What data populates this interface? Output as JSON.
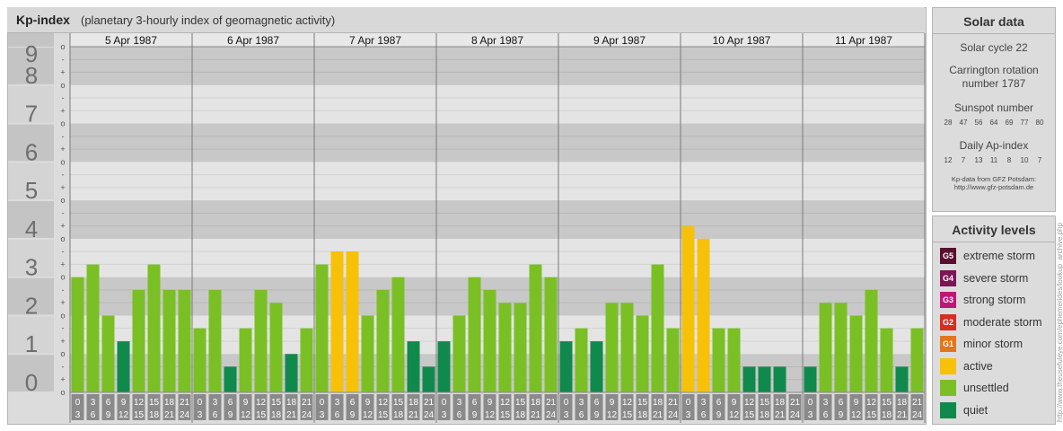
{
  "header": {
    "title": "Kp-index",
    "subtitle": "(planetary 3-hourly index of geomagnetic activity)"
  },
  "chart_data": {
    "type": "bar",
    "title": "Kp-index",
    "subtitle": "(planetary 3-hourly index of geomagnetic activity)",
    "ylim": [
      0,
      9
    ],
    "y_ticks": [
      "0",
      "1",
      "2",
      "3",
      "4",
      "5",
      "6",
      "7",
      "8",
      "9"
    ],
    "sub_ticks": [
      "-",
      "o",
      "+"
    ],
    "days": [
      "5 Apr 1987",
      "6 Apr 1987",
      "7 Apr 1987",
      "8 Apr 1987",
      "9 Apr 1987",
      "10 Apr 1987",
      "11 Apr 1987"
    ],
    "interval_top": [
      "0",
      "3",
      "6",
      "9",
      "12",
      "15",
      "18",
      "21"
    ],
    "interval_bottom": [
      "3",
      "6",
      "9",
      "12",
      "15",
      "18",
      "21",
      "24"
    ],
    "series": [
      {
        "values": [
          3.0,
          3.33,
          2.0,
          1.33,
          2.67,
          3.33,
          2.67,
          2.67
        ]
      },
      {
        "values": [
          1.67,
          2.67,
          0.67,
          1.67,
          2.67,
          2.33,
          1.0,
          1.67
        ]
      },
      {
        "values": [
          3.33,
          3.67,
          3.67,
          2.0,
          2.67,
          3.0,
          1.33,
          0.67
        ]
      },
      {
        "values": [
          1.33,
          2.0,
          3.0,
          2.67,
          2.33,
          2.33,
          3.33,
          3.0
        ]
      },
      {
        "values": [
          1.33,
          1.67,
          1.33,
          2.33,
          2.33,
          2.0,
          3.33,
          1.67
        ]
      },
      {
        "values": [
          4.33,
          4.0,
          1.67,
          1.67,
          0.67,
          0.67,
          0.67,
          0.0
        ]
      },
      {
        "values": [
          0.67,
          2.33,
          2.33,
          2.0,
          2.67,
          1.67,
          0.67,
          1.67
        ]
      }
    ],
    "colors": {
      "quiet": "#108a4c",
      "unsettled": "#7ac024",
      "active": "#f7c107"
    }
  },
  "solar": {
    "title": "Solar data",
    "cycle": "Solar cycle 22",
    "carrington": "Carrington rotation number 1787",
    "sunspot_label": "Sunspot number",
    "sunspot_values": [
      "28",
      "47",
      "56",
      "64",
      "69",
      "77",
      "80"
    ],
    "ap_label": "Daily Ap-index",
    "ap_values": [
      "12",
      "7",
      "13",
      "11",
      "8",
      "10",
      "7"
    ],
    "source_line1": "Kp-data from GFZ Potsdam:",
    "source_line2": "http://www.gfz-potsdam.de"
  },
  "activity": {
    "title": "Activity levels",
    "items": [
      {
        "code": "G5",
        "label": "extreme storm",
        "color": "#5b0f2f"
      },
      {
        "code": "G4",
        "label": "severe storm",
        "color": "#7e1453"
      },
      {
        "code": "G3",
        "label": "strong storm",
        "color": "#bd1878"
      },
      {
        "code": "G2",
        "label": "moderate storm",
        "color": "#d72f1d"
      },
      {
        "code": "G1",
        "label": "minor storm",
        "color": "#e4751b"
      },
      {
        "code": "",
        "label": "active",
        "color": "#f7c107"
      },
      {
        "code": "",
        "label": "unsettled",
        "color": "#7ac024"
      },
      {
        "code": "",
        "label": "quiet",
        "color": "#108a4c"
      }
    ]
  },
  "watermark": "http://www.theusefuleye.com/ephemerides/lookup_archive.php"
}
